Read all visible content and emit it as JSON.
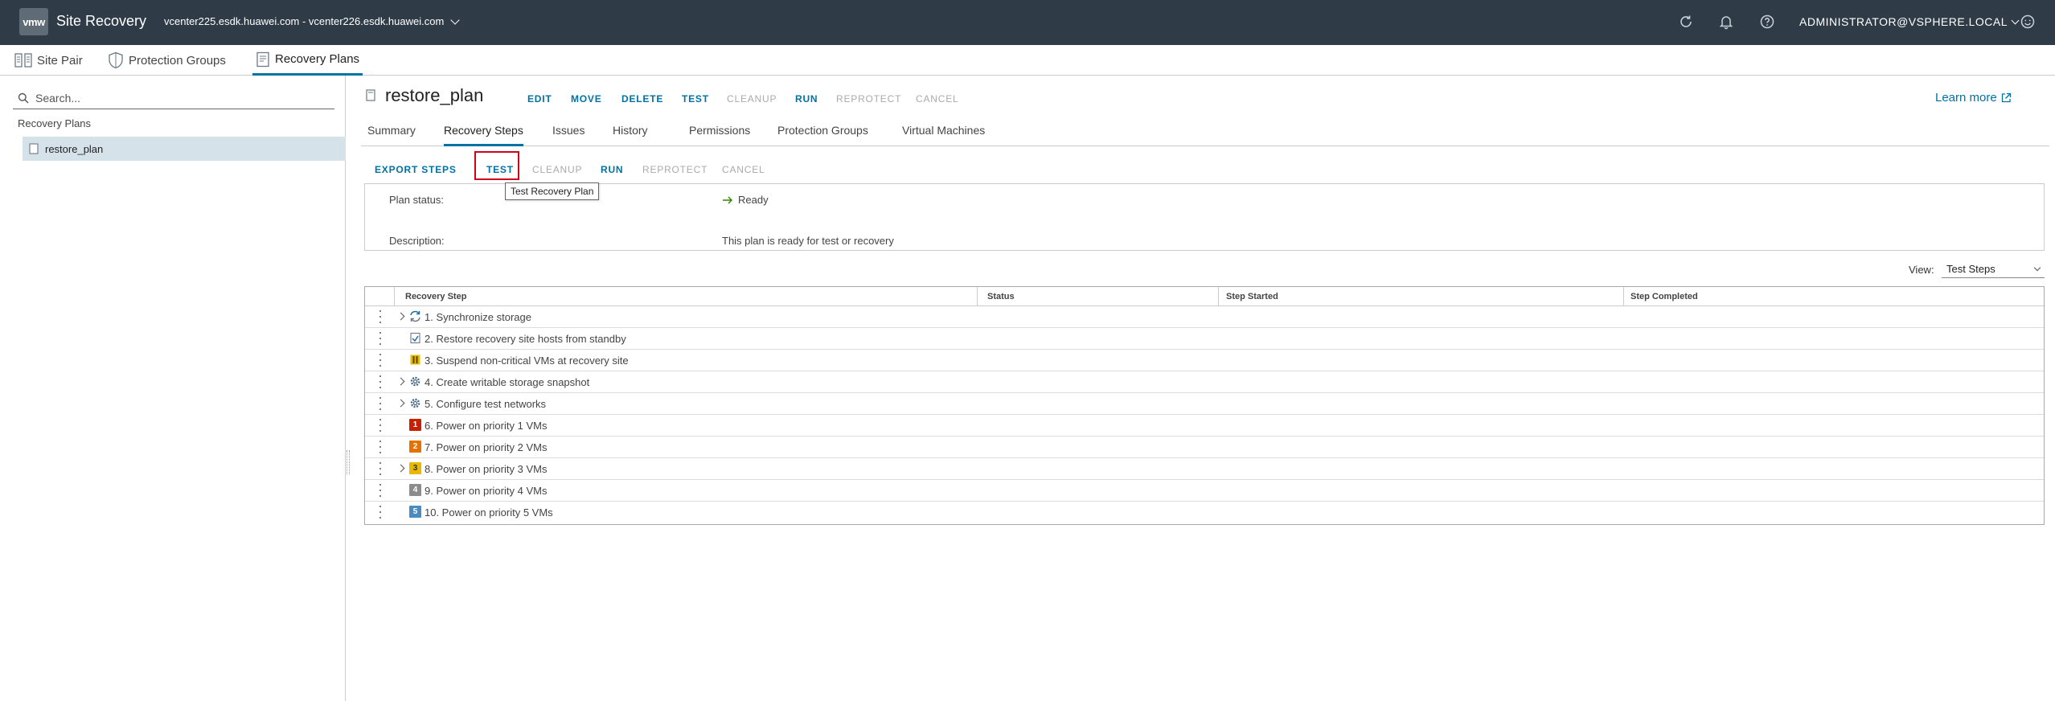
{
  "header": {
    "logo_text": "vmw",
    "app_title": "Site Recovery",
    "site_pair_selector": "vcenter225.esdk.huawei.com - vcenter226.esdk.huawei.com",
    "user": "Administrator@VSPHERE.LOCAL"
  },
  "nav": {
    "tabs": [
      {
        "label": "Site Pair",
        "icon": "site-pair-icon"
      },
      {
        "label": "Protection Groups",
        "icon": "shield-icon"
      },
      {
        "label": "Recovery Plans",
        "icon": "recovery-plan-icon",
        "active": true
      }
    ]
  },
  "sidebar": {
    "search_placeholder": "Search...",
    "heading": "Recovery Plans",
    "items": [
      {
        "label": "restore_plan",
        "selected": true
      }
    ]
  },
  "plan": {
    "title": "restore_plan",
    "actions": [
      {
        "label": "EDIT",
        "enabled": true
      },
      {
        "label": "MOVE",
        "enabled": true
      },
      {
        "label": "DELETE",
        "enabled": true
      },
      {
        "label": "TEST",
        "enabled": true
      },
      {
        "label": "CLEANUP",
        "enabled": false
      },
      {
        "label": "RUN",
        "enabled": true
      },
      {
        "label": "REPROTECT",
        "enabled": false
      },
      {
        "label": "CANCEL",
        "enabled": false
      }
    ],
    "learn_more": "Learn more"
  },
  "subtabs": [
    "Summary",
    "Recovery Steps",
    "Issues",
    "History",
    "Permissions",
    "Protection Groups",
    "Virtual Machines"
  ],
  "active_subtab": "Recovery Steps",
  "steps_toolbar": {
    "actions": [
      {
        "label": "EXPORT STEPS",
        "enabled": true
      },
      {
        "label": "TEST",
        "enabled": true
      },
      {
        "label": "CLEANUP",
        "enabled": false
      },
      {
        "label": "RUN",
        "enabled": true
      },
      {
        "label": "REPROTECT",
        "enabled": false
      },
      {
        "label": "CANCEL",
        "enabled": false
      }
    ],
    "tooltip": "Test Recovery Plan"
  },
  "details": {
    "status_label": "Plan status:",
    "status_value": "Ready",
    "description_label": "Description:",
    "description_value": "This plan is ready for test or recovery"
  },
  "view": {
    "label": "View:",
    "value": "Test Steps"
  },
  "grid": {
    "columns": [
      "Recovery Step",
      "Status",
      "Step Started",
      "Step Completed"
    ],
    "rows": [
      {
        "label": "1. Synchronize storage",
        "expandable": true,
        "icon": "sync-icon"
      },
      {
        "label": "2. Restore recovery site hosts from standby",
        "expandable": false,
        "icon": "host-restore-icon"
      },
      {
        "label": "3. Suspend non-critical VMs at recovery site",
        "expandable": false,
        "icon": "pause-icon"
      },
      {
        "label": "4. Create writable storage snapshot",
        "expandable": true,
        "icon": "gear-icon"
      },
      {
        "label": "5. Configure test networks",
        "expandable": true,
        "icon": "gear-icon"
      },
      {
        "label": "6. Power on priority 1 VMs",
        "expandable": false,
        "icon": "priority-badge",
        "badge": "1",
        "badge_color": "#c92100"
      },
      {
        "label": "7. Power on priority 2 VMs",
        "expandable": false,
        "icon": "priority-badge",
        "badge": "2",
        "badge_color": "#e57200"
      },
      {
        "label": "8. Power on priority 3 VMs",
        "expandable": true,
        "icon": "priority-badge",
        "badge": "3",
        "badge_color": "#e8b900"
      },
      {
        "label": "9. Power on priority 4 VMs",
        "expandable": false,
        "icon": "priority-badge",
        "badge": "4",
        "badge_color": "#8c8c8c"
      },
      {
        "label": "10. Power on priority 5 VMs",
        "expandable": false,
        "icon": "priority-badge",
        "badge": "5",
        "badge_color": "#4a8bc2"
      }
    ]
  },
  "colors": {
    "header_bg": "#2f3c48",
    "accent": "#0072a3",
    "selected_row": "#d6e2ea",
    "highlight": "#d0021b",
    "ready_arrow": "#2e8500"
  }
}
